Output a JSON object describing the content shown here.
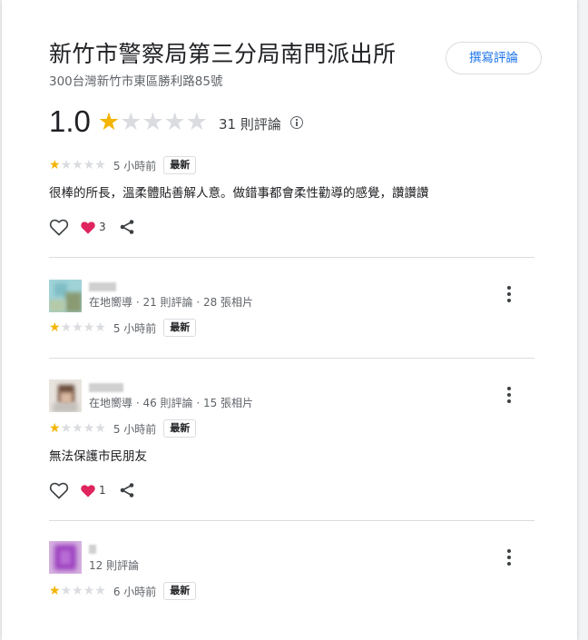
{
  "place": {
    "title": "新竹市警察局第三分局南門派出所",
    "address": "300台灣新竹市東區勝利路85號",
    "write_review_label": "撰寫評論",
    "rating": "1.0",
    "rating_stars": 1,
    "review_count_label": "31 則評論"
  },
  "reviews": [
    {
      "stars": 1,
      "time": "5 小時前",
      "badge": "最新",
      "text": "很棒的所長，溫柔體貼善解人意。做錯事都會柔性勸導的感覺，讚讚讚",
      "reaction_count": "3"
    },
    {
      "reviewer_meta": "在地嚮導 · 21 則評論 · 28 張相片",
      "stars": 1,
      "time": "5 小時前",
      "badge": "最新"
    },
    {
      "reviewer_meta": "在地嚮導 · 46 則評論 · 15 張相片",
      "stars": 1,
      "time": "5 小時前",
      "badge": "最新",
      "text": "無法保護市民朋友",
      "reaction_count": "1"
    },
    {
      "reviewer_meta": "12 則評論",
      "stars": 1,
      "time": "6 小時前",
      "badge": "最新"
    }
  ],
  "colors": {
    "star_filled": "#f4b400",
    "star_empty": "#dadce0",
    "link_blue": "#1a73e8",
    "heart_red": "#e0245e"
  },
  "icons": {
    "info": "info-icon",
    "heart": "heart-outline-icon",
    "reaction": "red-heart-emoji-icon",
    "share": "share-icon",
    "more": "more-vert-icon"
  }
}
